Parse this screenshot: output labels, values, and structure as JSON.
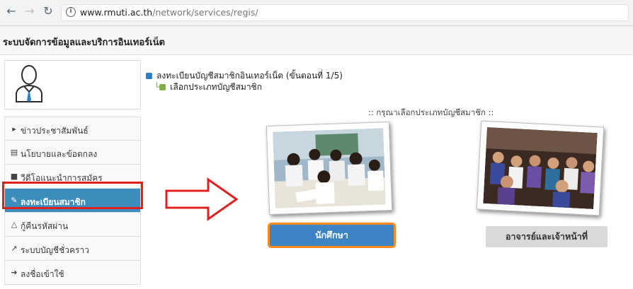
{
  "browser": {
    "url_host": "www.rmuti.ac.th",
    "url_path": "/network/services/regis/"
  },
  "header": {
    "title": "ระบบจัดการข้อมูลและบริการอินเทอร์เน็ต"
  },
  "sidebar": {
    "items": [
      {
        "icon": "megaphone-icon",
        "label": "ข่าวประชาสัมพันธ์"
      },
      {
        "icon": "document-icon",
        "label": "นโยบายและข้อตกลง"
      },
      {
        "icon": "video-icon",
        "label": "วีดีโอแนะนำการสมัคร"
      },
      {
        "icon": "edit-icon",
        "label": "ลงทะเบียนสมาชิก",
        "active": true
      },
      {
        "icon": "bell-icon",
        "label": "กู้คืนรหัสผ่าน"
      },
      {
        "icon": "external-link-icon",
        "label": "ระบบบัญชีชั่วคราว"
      },
      {
        "icon": "sign-in-icon",
        "label": "ลงชื่อเข้าใช้"
      }
    ]
  },
  "main": {
    "breadcrumb_step": "ลงทะเบียนบัญชีสมาชิกอินเทอร์เน็ต (ขั้นตอนที่ 1/5)",
    "breadcrumb_sub": "เลือกประเภทบัญชีสมาชิก",
    "choose_label": ":: กรุณาเลือกประเภทบัญชีสมาชิก ::",
    "student_button": "นักศึกษา",
    "staff_button": "อาจารย์และเจ้าหน้าที่"
  },
  "colors": {
    "accent": "#3c8dbc",
    "highlight_red": "#e02020",
    "highlight_orange": "#ff8c1a"
  }
}
